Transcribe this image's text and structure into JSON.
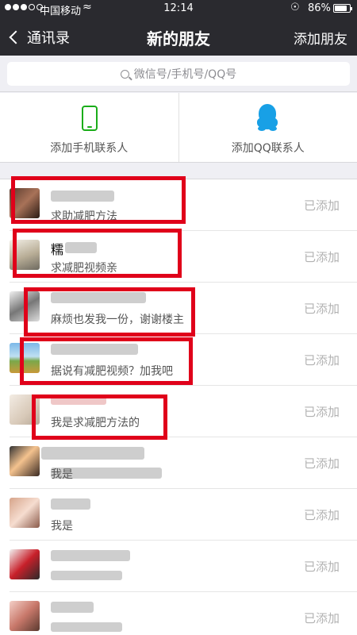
{
  "status_bar": {
    "carrier": "中国移动",
    "time": "12:14",
    "battery": "86%",
    "battery_level": 0.86
  },
  "nav": {
    "back_label": "通讯录",
    "title": "新的朋友",
    "action_label": "添加朋友"
  },
  "search": {
    "placeholder": "微信号/手机号/QQ号"
  },
  "add_options": {
    "phone_label": "添加手机联系人",
    "qq_label": "添加QQ联系人"
  },
  "friend_requests": [
    {
      "name": "",
      "message": "求助减肥方法",
      "status": "已添加"
    },
    {
      "name": "糯",
      "message": "求减肥视频亲",
      "status": "已添加"
    },
    {
      "name": "",
      "message": "麻烦也发我一份，谢谢楼主",
      "status": "已添加"
    },
    {
      "name": "",
      "message": "据说有减肥视频？加我吧",
      "status": "已添加"
    },
    {
      "name": "",
      "message": "我是求减肥方法的",
      "status": "已添加"
    },
    {
      "name": "",
      "message": "我是",
      "status": "已添加"
    },
    {
      "name": "",
      "message": "我是",
      "status": "已添加"
    },
    {
      "name": "",
      "message": "",
      "status": "已添加"
    },
    {
      "name": "",
      "message": "",
      "status": "已添加"
    }
  ],
  "colors": {
    "nav_bg": "#2a2a2f",
    "annotation": "#e0001a",
    "wechat_green": "#1aad19",
    "qq_blue": "#18a0e6"
  }
}
